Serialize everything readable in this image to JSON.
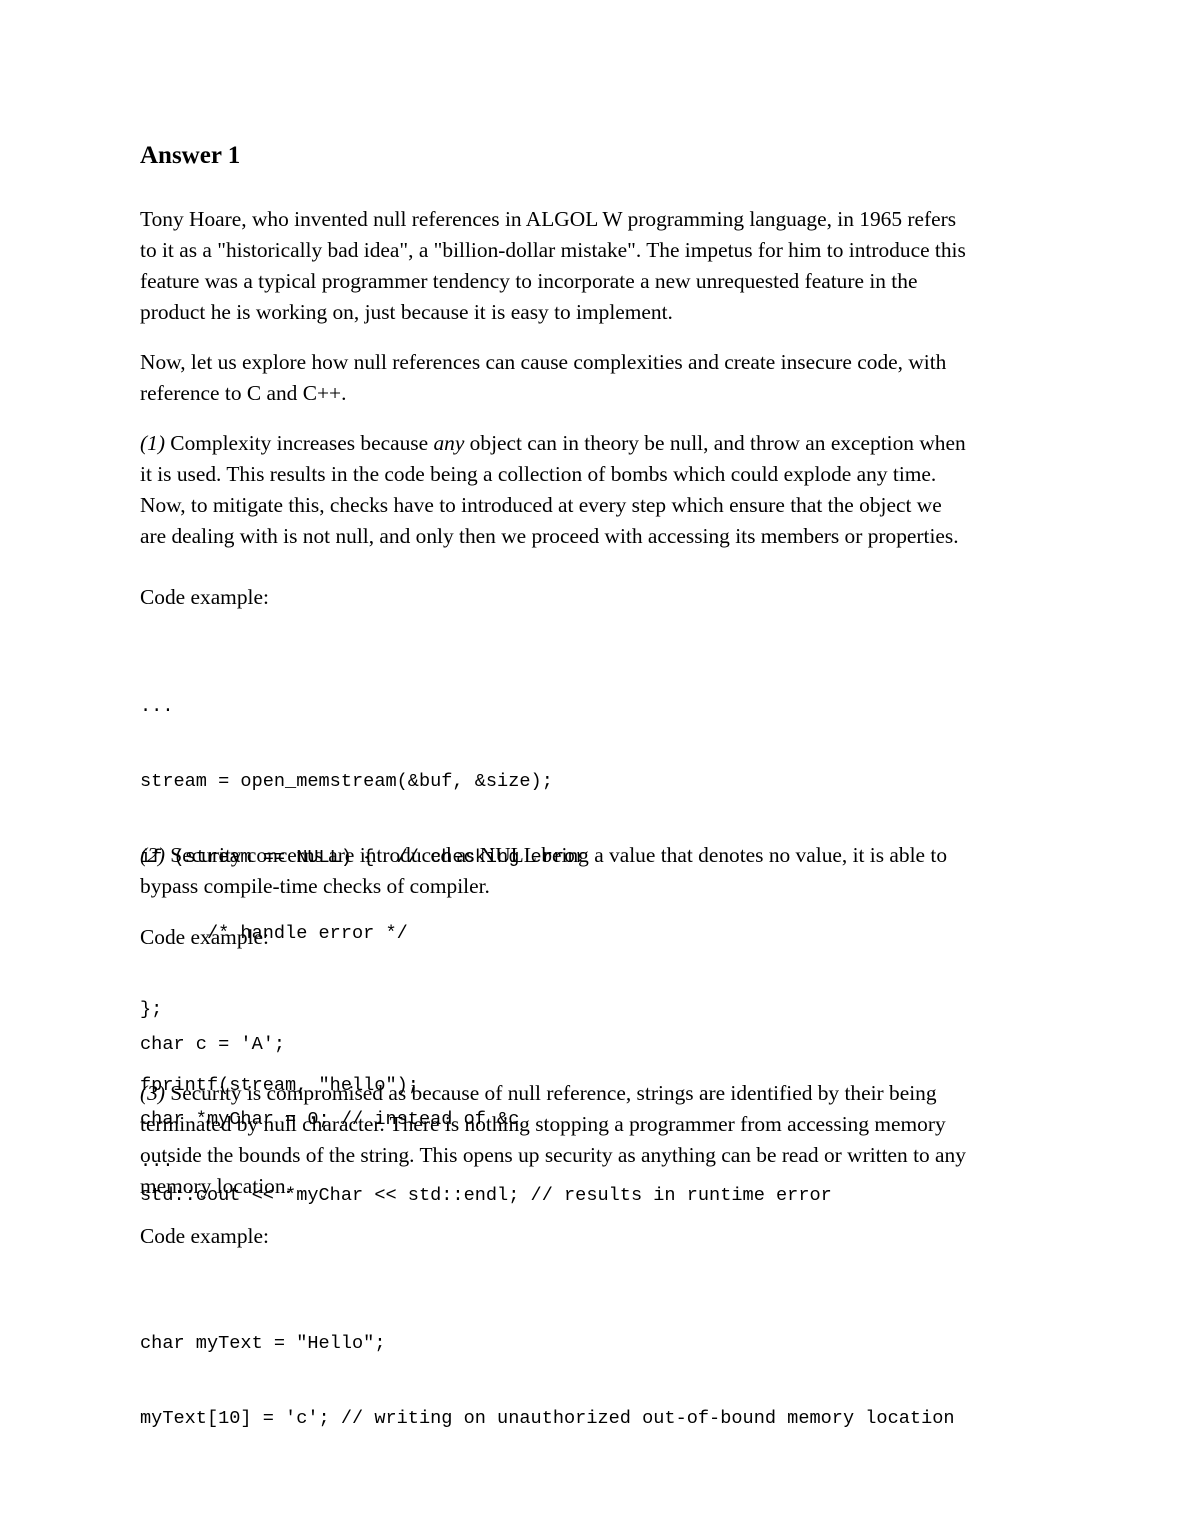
{
  "document": {
    "heading": "Answer 1",
    "intro": {
      "lines": [
        "Tony Hoare, who invented null references in ALGOL W programming language, in 1965 refers",
        "to it as a \"historically bad idea\", a \"billion-dollar mistake\". The impetus for him to introduce this",
        "feature was a typical programmer tendency to incorporate a new unrequested feature in the",
        "product he is working on, just because it is easy to implement."
      ]
    },
    "explore": {
      "lines": [
        "Now, let us explore how null references can cause complexities and create insecure code, with",
        "reference to C and C++."
      ]
    },
    "point1": {
      "number": "(1)",
      "line1_a": " Complexity increases because ",
      "line1_em": "any",
      "line1_b": " object can in theory be null, and throw an exception when",
      "lines": [
        "it is used. This results in the code being a collection of bombs which could explode any time.",
        "Now, to mitigate this, checks have to introduced at every step which ensure that the object we",
        "are dealing with is not null, and only then we proceed with accessing its members or properties."
      ]
    },
    "code_label_1": "Code example:",
    "code_1": [
      "...",
      "stream = open_memstream(&buf, &size);",
      "if (stream == NULL) {  // checking error",
      "      /* handle error */",
      "};",
      "fprintf(stream, \"hello\");",
      "..."
    ],
    "point2": {
      "number": "(2)",
      "line1": " Security concerns are introduced as NULL being a value that denotes no value, it is able to",
      "lines": [
        "bypass compile-time checks of compiler."
      ]
    },
    "code_label_2": "Code example:",
    "code_2": [
      "char c = 'A';",
      "char *myChar = 0; // instead of &c",
      "std::cout << *myChar << std::endl; // results in runtime error"
    ],
    "point3": {
      "number": "(3)",
      "line1": " Security is compromised as because of null reference, strings are identified by their being",
      "lines": [
        "terminated by null character. There is nothing stopping a programmer from accessing memory",
        "outside the bounds of the string. This opens up security as anything can be read or written to any",
        "memory location."
      ]
    },
    "code_label_3": "Code example:",
    "code_3": [
      "char myText = \"Hello\";",
      "myText[10] = 'c'; // writing on unauthorized out-of-bound memory location"
    ]
  }
}
